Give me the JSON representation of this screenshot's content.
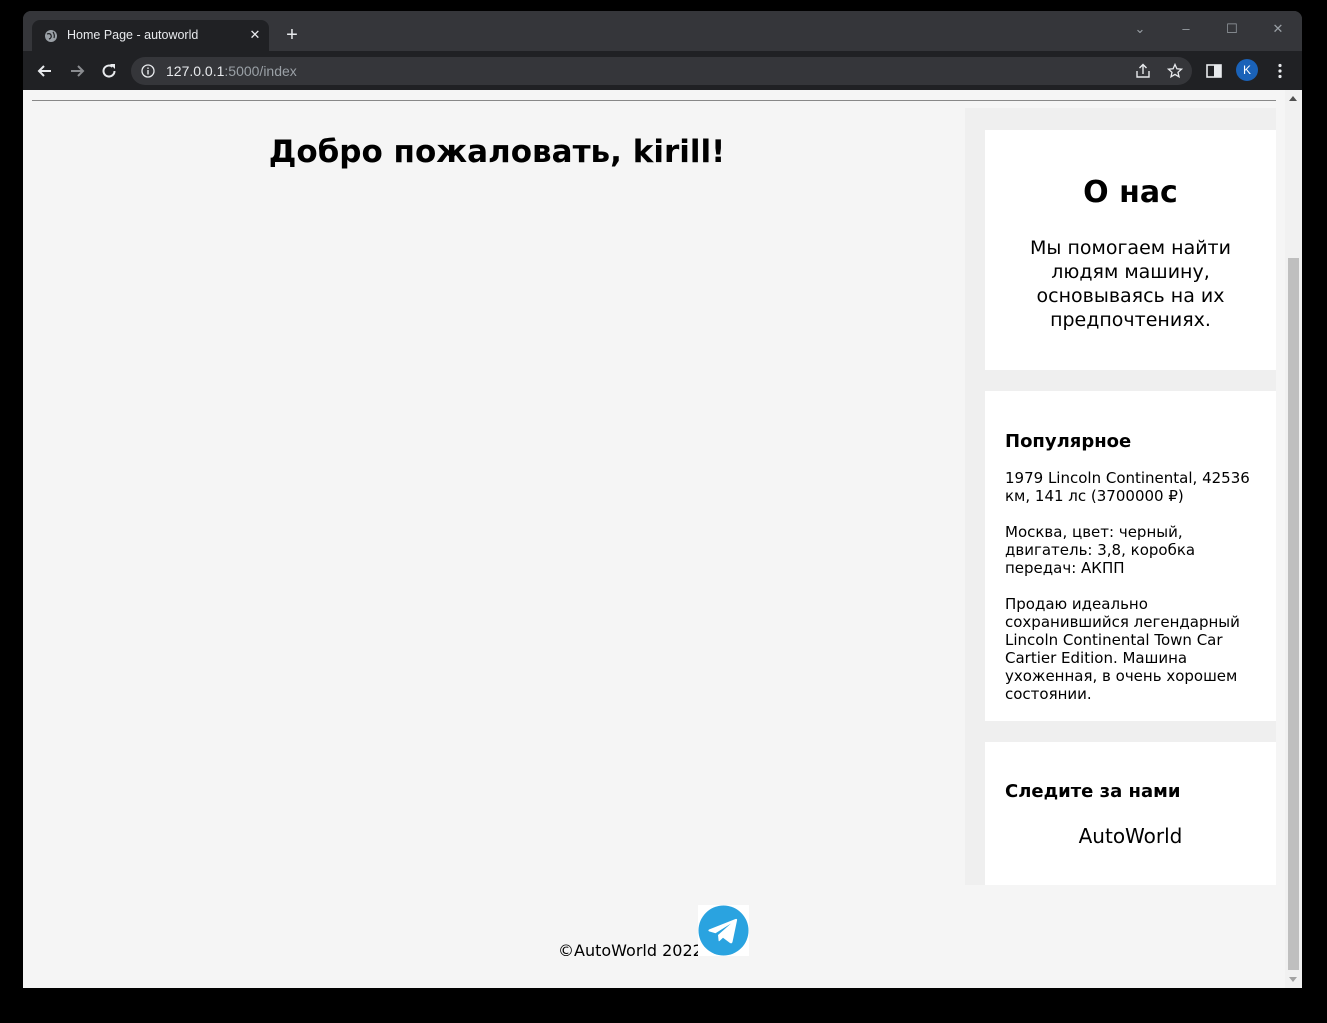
{
  "browser": {
    "tab_title": "Home Page - autoworld",
    "tab_close": "✕",
    "new_tab": "+",
    "url_host": "127.0.0.1",
    "url_rest": ":5000/index",
    "profile_initial": "K",
    "window_controls": {
      "dropdown": "⌄",
      "minimize": "–",
      "maximize": "☐",
      "close": "✕"
    }
  },
  "page": {
    "welcome": "Добро пожаловать, kirill!",
    "about": {
      "title": "О нас",
      "text": "Мы помогаем найти людям машину, основываясь на их предпочтениях."
    },
    "popular": {
      "title": "Популярное",
      "line1": "1979 Lincoln Continental, 42536 км, 141 лс (3700000 ₽)",
      "line2": "Москва, цвет: черный, двигатель: 3,8, коробка передач: АКПП",
      "line3": "Продаю идеально сохранившийся легендарный Lincoln Continental Town Car Cartier Edition. Машина ухоженная, в очень хорошем состоянии."
    },
    "follow": {
      "title": "Следите за нами",
      "brand": "AutoWorld"
    },
    "footer": {
      "copyright": "©AutoWorld 2022",
      "social_icon": "telegram-icon"
    }
  },
  "colors": {
    "page_bg": "#f5f5f5",
    "card_bg": "#ffffff",
    "telegram": "#2aa3e0"
  }
}
